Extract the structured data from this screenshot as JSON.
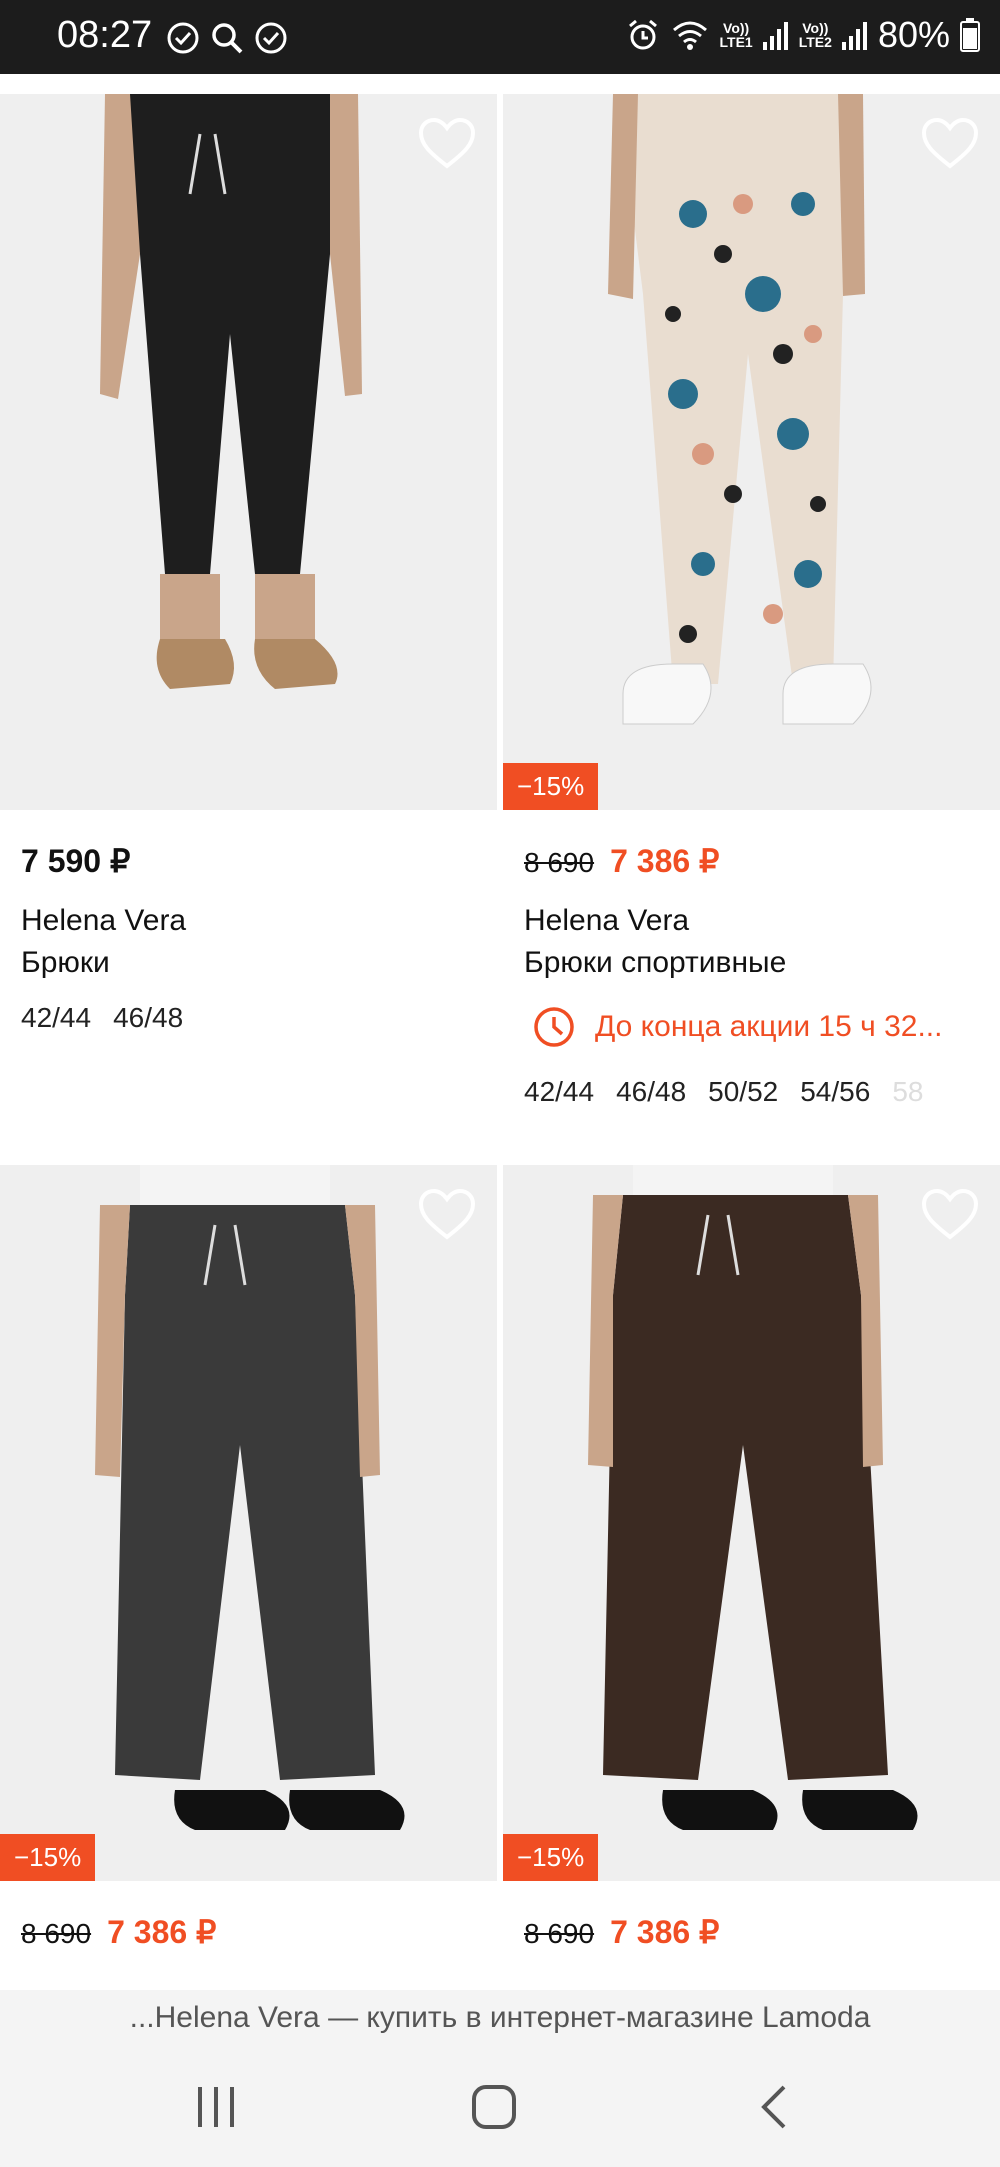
{
  "status_bar": {
    "time": "08:27",
    "battery_percent": "80%",
    "sim1_label": "Vo))",
    "sim1_net": "LTE1",
    "sim2_label": "Vo))",
    "sim2_net": "LTE2"
  },
  "products": [
    {
      "price": "7 590 ₽",
      "brand": "Helena Vera",
      "name": "Брюки",
      "sizes": [
        "42/44",
        "46/48"
      ],
      "pants_color": "#1e1e1e"
    },
    {
      "discount_badge": "−15%",
      "old_price": "8 690",
      "new_price": "7 386 ₽",
      "brand": "Helena Vera",
      "name": "Брюки спортивные",
      "promo_text": "До конца акции 15 ч 32...",
      "sizes": [
        "42/44",
        "46/48",
        "50/52",
        "54/56",
        "58"
      ],
      "pants_color": "#e9ddd0"
    },
    {
      "discount_badge": "−15%",
      "old_price": "8 690",
      "new_price": "7 386 ₽",
      "pants_color": "#3a3a3a"
    },
    {
      "discount_badge": "−15%",
      "old_price": "8 690",
      "new_price": "7 386 ₽",
      "pants_color": "#3b2a22"
    }
  ],
  "browser": {
    "page_title": "...Helena Vera — купить в интернет-магазине Lamoda"
  },
  "colors": {
    "accent": "#f04e23",
    "statusbar_bg": "#1c1c1c"
  }
}
